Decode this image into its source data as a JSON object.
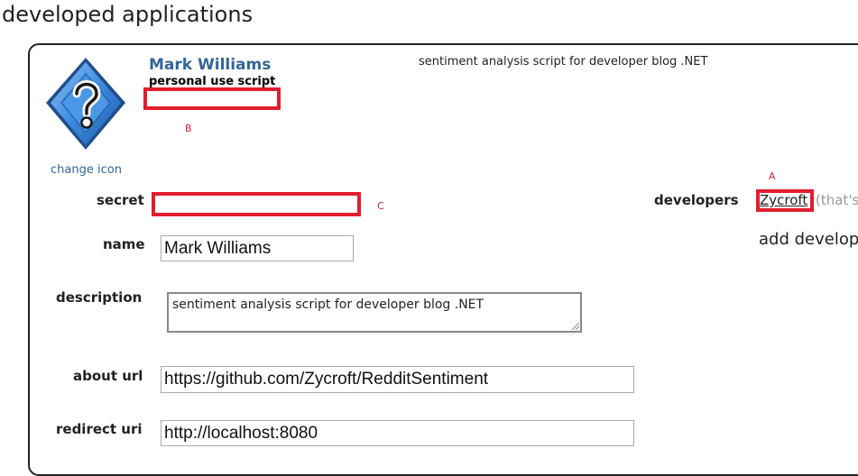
{
  "page": {
    "heading": "developed applications"
  },
  "app": {
    "name": "Mark Williams",
    "type_label": "personal use script",
    "change_icon_label": "change icon",
    "description_preview": "sentiment analysis script for developer blog .NET"
  },
  "icon": "question-mark-diamond-icon",
  "annotations": {
    "marker_a": "A",
    "marker_b": "B",
    "marker_c": "C",
    "highlight_color": "#e21e2e"
  },
  "form": {
    "secret_label": "secret",
    "name_label": "name",
    "name_value": "Mark Williams",
    "description_label": "description",
    "description_value": "sentiment analysis script for developer blog .NET",
    "about_url_label": "about url",
    "about_url_value": "https://github.com/Zycroft/RedditSentiment",
    "redirect_uri_label": "redirect uri",
    "redirect_uri_value": "http://localhost:8080"
  },
  "developers": {
    "label": "developers",
    "name": "Zycroft",
    "note": "(that's",
    "add_label": "add develop"
  },
  "colors": {
    "link": "#336699",
    "icon_blue": "#2f7fd8"
  }
}
